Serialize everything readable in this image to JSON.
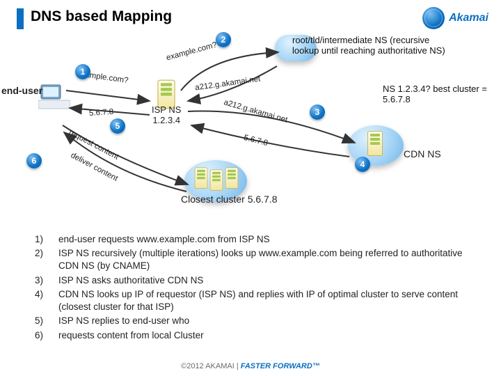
{
  "header": {
    "title": "DNS based Mapping",
    "brand": "Akamai"
  },
  "labels": {
    "end_user": "end-user",
    "root_ns": "root/tld/intermediate NS (recursive lookup until reaching authoritative NS)",
    "best_cluster": "NS 1.2.3.4? best cluster = 5.6.7.8",
    "isp_ns_name": "ISP NS",
    "isp_ns_ip": "1.2.3.4",
    "cdn_ns": "CDN NS",
    "closest": "Closest cluster 5.6.7.8"
  },
  "nums": {
    "1": "1",
    "2": "2",
    "3": "3",
    "4": "4",
    "5": "5",
    "6": "6"
  },
  "arrows": {
    "q_to_isp": "example.com?",
    "isp_to_root": "example.com?",
    "root_to_isp": "a212.g.akamai.net",
    "isp_to_cdn": "a212.g.akamai.net",
    "cdn_to_isp": "5.6.7.8",
    "isp_to_user": "5.6.7.8",
    "request": "request content",
    "deliver": "deliver content"
  },
  "steps": [
    {
      "n": "1)",
      "t": "end-user requests www.example.com from ISP NS"
    },
    {
      "n": "2)",
      "t": "ISP NS recursively (multiple iterations) looks up www.example.com being referred to authoritative CDN NS (by CNAME)"
    },
    {
      "n": "3)",
      "t": "ISP NS asks authoritative CDN NS"
    },
    {
      "n": "4)",
      "t": "CDN NS looks up IP of requestor (ISP NS) and replies with IP of optimal cluster to serve content (closest cluster for that ISP)"
    },
    {
      "n": "5)",
      "t": "ISP NS replies to end-user who"
    },
    {
      "n": "6)",
      "t": "requests content from local Cluster"
    }
  ],
  "footer": {
    "copy": "©2012 AKAMAI  |  ",
    "fwd": "FASTER FORWARD™"
  }
}
